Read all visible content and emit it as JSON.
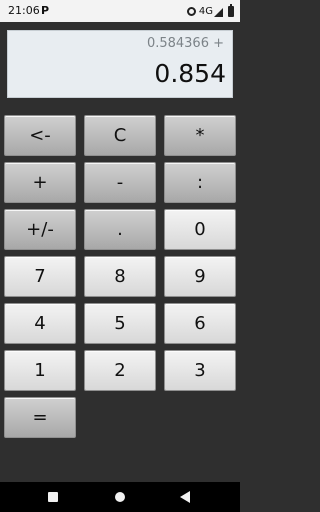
{
  "status_bar": {
    "time": "21:06",
    "p_indicator": "P",
    "network": "4G"
  },
  "display": {
    "expression": "0.584366 +",
    "result": "0.854"
  },
  "keys": {
    "backspace": "<-",
    "clear": "C",
    "multiply": "*",
    "add": "+",
    "subtract": "-",
    "divide": ":",
    "negate": "+/-",
    "decimal": ".",
    "zero": "0",
    "seven": "7",
    "eight": "8",
    "nine": "9",
    "four": "4",
    "five": "5",
    "six": "6",
    "one": "1",
    "two": "2",
    "three": "3",
    "equals": "="
  }
}
